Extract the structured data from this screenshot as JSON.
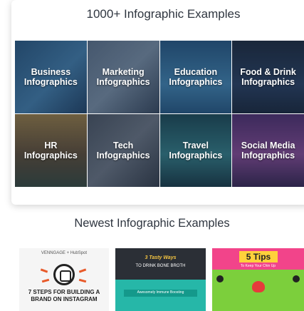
{
  "categories_section": {
    "title": "1000+ Infographic Examples",
    "tiles": [
      {
        "label": "Business\nInfographics",
        "color": "#3a6f9a"
      },
      {
        "label": "Marketing\nInfographics",
        "color": "#5a6c80"
      },
      {
        "label": "Education\nInfographics",
        "color": "#3f7fa8"
      },
      {
        "label": "Food & Drink\nInfographics",
        "color": "#2b3c5c"
      },
      {
        "label": "HR\nInfographics",
        "color": "#6e5a3a"
      },
      {
        "label": "Tech\nInfographics",
        "color": "#4e5560"
      },
      {
        "label": "Travel\nInfographics",
        "color": "#2e6f74"
      },
      {
        "label": "Social Media\nInfographics",
        "color": "#6b3f7e"
      }
    ]
  },
  "newest_section": {
    "title": "Newest Infographic Examples",
    "thumbs": [
      {
        "brand": "VENNGAGE + HubSpot",
        "headline": "7 STEPS FOR BUILDING A\nBRAND ON INSTAGRAM"
      },
      {
        "line1": "3 Tasty Ways",
        "line2": "TO DRINK BONE BROTH",
        "bar": "Awesomely Immune Boosting"
      },
      {
        "tips": "5 Tips",
        "sub": "To Keep Your Chin Up"
      }
    ]
  }
}
